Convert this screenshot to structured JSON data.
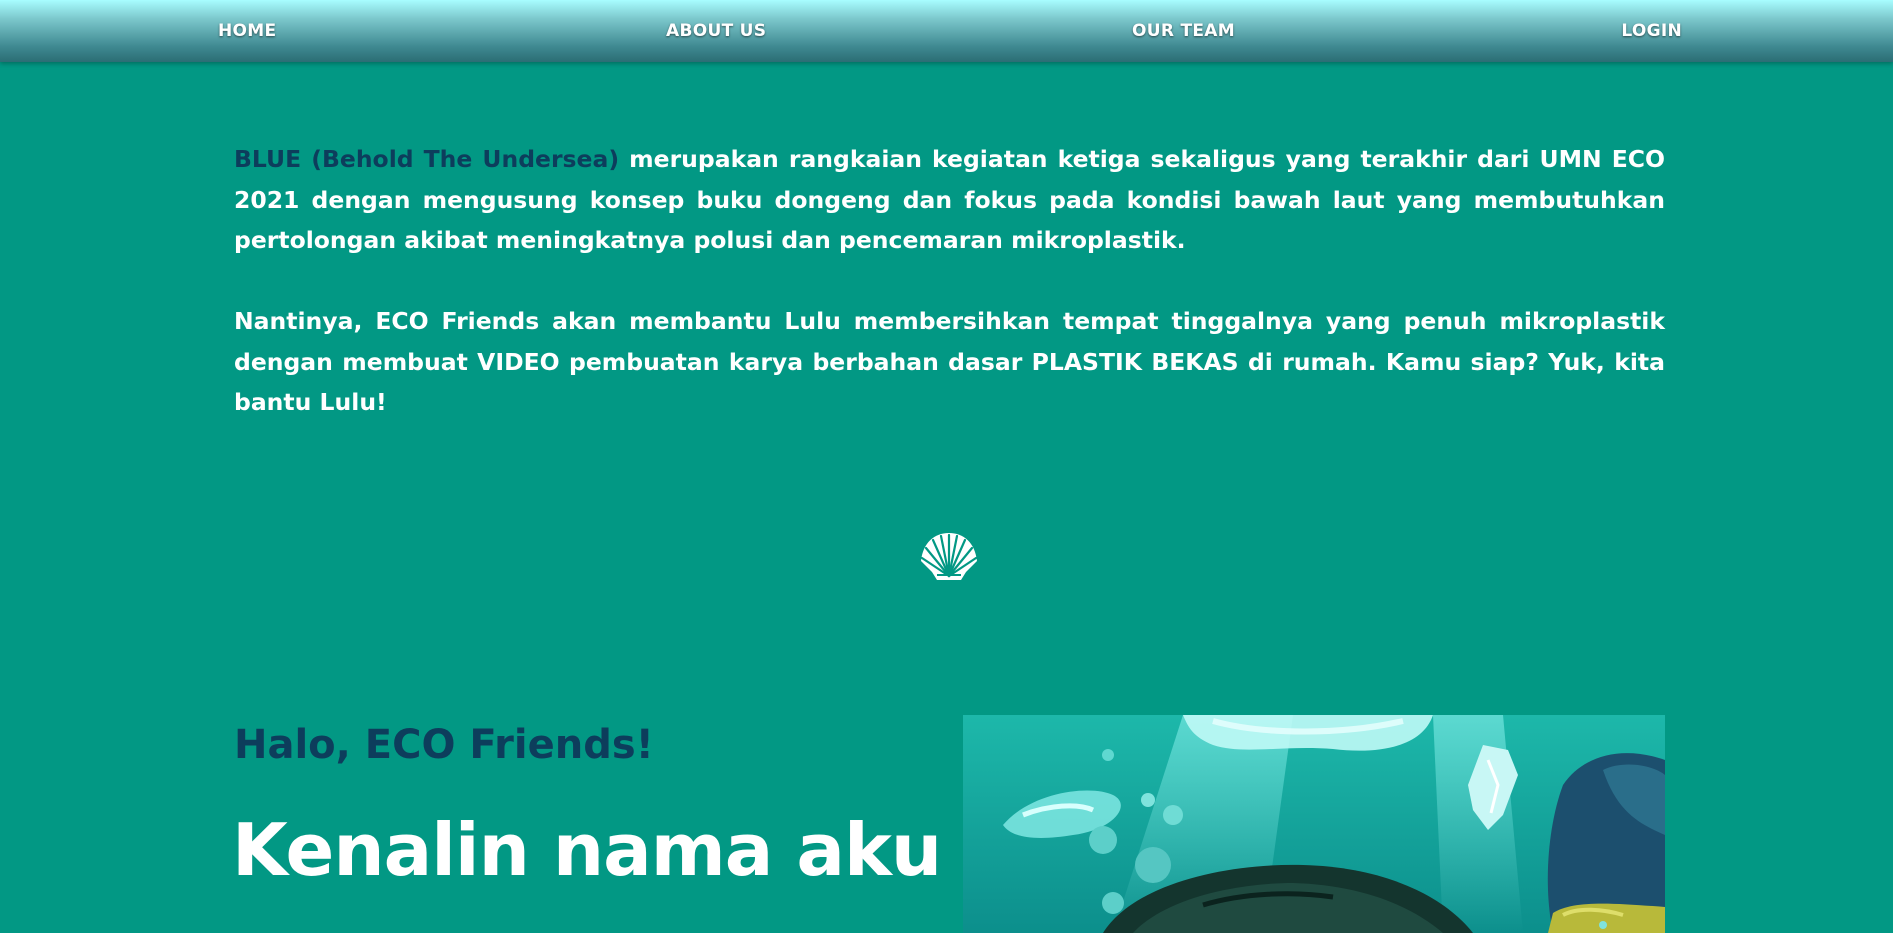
{
  "nav": {
    "home": "HOME",
    "about": "ABOUT US",
    "team": "OUR TEAM",
    "login": "LOGIN"
  },
  "intro": {
    "highlight": "BLUE (Behold The Undersea)",
    "p1_rest": " merupakan rangkaian kegiatan ketiga sekaligus yang terakhir dari UMN ECO 2021 dengan mengusung konsep buku dongeng dan fokus pada kondisi bawah laut yang membutuhkan pertolongan akibat meningkatnya polusi dan pencemaran mikroplastik.",
    "p2": "Nantinya, ECO Friends akan membantu Lulu membersihkan tempat tinggalnya yang penuh mikroplastik dengan membuat VIDEO pembuatan karya berbahan dasar PLASTIK BEKAS di rumah. Kamu siap? Yuk, kita bantu Lulu!"
  },
  "divider_icon": "seashell-icon",
  "section": {
    "greeting": "Halo, ECO Friends!",
    "headline": "Kenalin nama aku"
  },
  "illustration": "underwater-scene",
  "colors": {
    "background": "#029884",
    "highlight_text": "#0d3d5c",
    "body_text": "#ffffff"
  }
}
